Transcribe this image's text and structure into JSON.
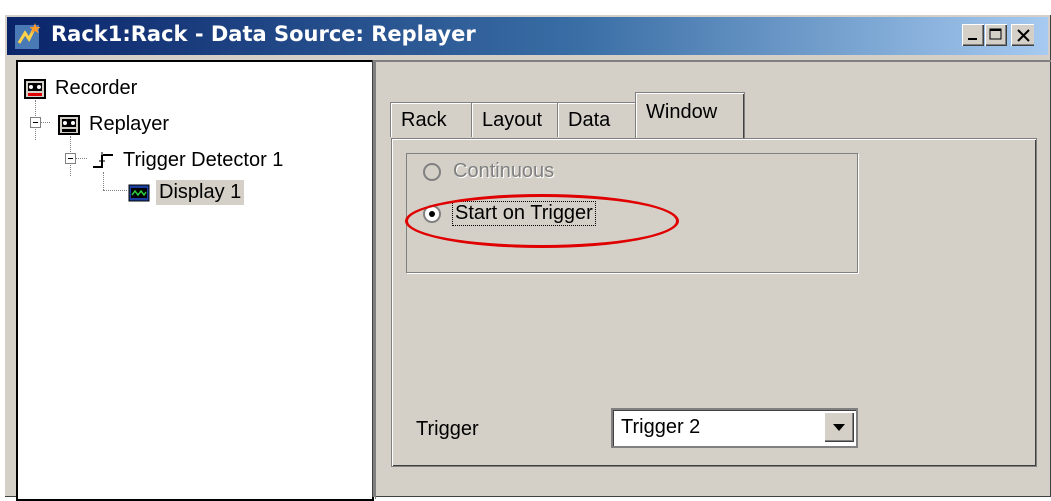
{
  "window": {
    "title": "Rack1:Rack - Data Source: Replayer",
    "controls": {
      "minimize": "minimize-icon",
      "maximize": "maximize-icon",
      "close": "close-icon"
    }
  },
  "tree": {
    "items": [
      {
        "label": "Recorder",
        "icon": "recorder-icon"
      },
      {
        "label": "Replayer",
        "icon": "replayer-icon"
      },
      {
        "label": "Trigger Detector 1",
        "icon": "trigger-detector-icon"
      },
      {
        "label": "Display 1",
        "icon": "display-icon",
        "selected": true
      }
    ]
  },
  "tabs": [
    {
      "label": "Rack"
    },
    {
      "label": "Layout"
    },
    {
      "label": "Data"
    },
    {
      "label": "Window",
      "active": true
    }
  ],
  "window_tab": {
    "radio_continuous": {
      "label": "Continuous",
      "enabled": false,
      "checked": false
    },
    "radio_start_on_trigger": {
      "label": "Start on Trigger",
      "enabled": true,
      "checked": true
    },
    "trigger_label": "Trigger",
    "trigger_select": {
      "value": "Trigger 2"
    }
  },
  "colors": {
    "title_bar_start": "#0a246a",
    "title_bar_end": "#a6caf0",
    "annotation_ellipse": "#e00000",
    "face": "#d4d0c8"
  }
}
